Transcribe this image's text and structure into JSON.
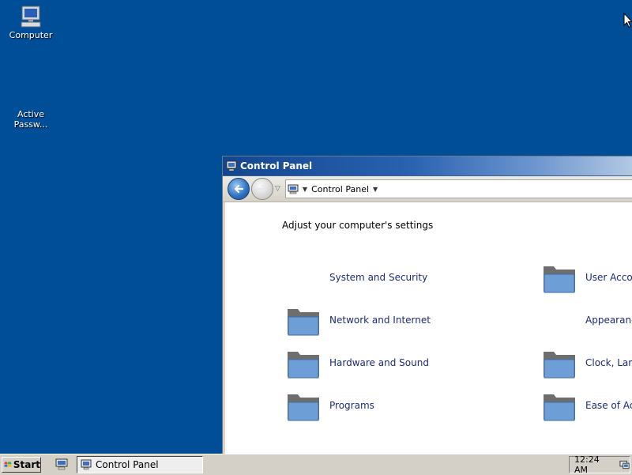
{
  "desktop": {
    "icons": [
      {
        "label": "Computer",
        "icon": "computer-icon"
      },
      {
        "label": "Active\nPassw...",
        "icon": "active-password-icon"
      }
    ]
  },
  "window": {
    "title": "Control Panel",
    "title_icon": "control-panel-icon",
    "address": {
      "segment": "Control Panel"
    },
    "heading": "Adjust your computer's settings",
    "categories": [
      {
        "label": "System and Security",
        "icon": "none"
      },
      {
        "label": "User Acco",
        "icon": "folder-icon"
      },
      {
        "label": "Network and Internet",
        "icon": "folder-icon"
      },
      {
        "label": "Appearanc",
        "icon": "none"
      },
      {
        "label": "Hardware and Sound",
        "icon": "folder-icon"
      },
      {
        "label": "Clock, Lan",
        "icon": "folder-icon"
      },
      {
        "label": "Programs",
        "icon": "folder-icon"
      },
      {
        "label": "Ease of Ac",
        "icon": "folder-icon"
      }
    ]
  },
  "taskbar": {
    "start_label": "Start",
    "tasks": [
      {
        "label": "Control Panel",
        "icon": "control-panel-icon"
      }
    ],
    "clock": "12:24 AM",
    "colors": {
      "desktop": "#004e98",
      "taskbar": "#d4d0c8",
      "link": "#1a2b7a"
    }
  }
}
